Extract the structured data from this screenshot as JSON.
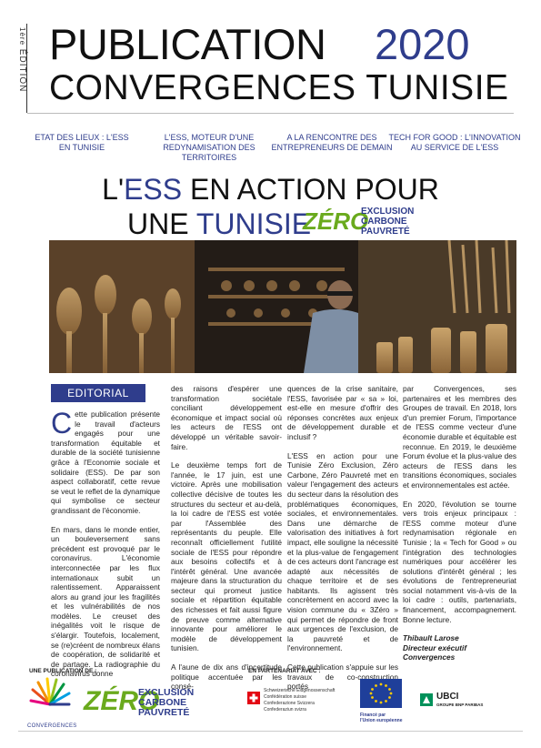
{
  "header": {
    "edition_sup": "1ère",
    "edition": "ÉDITION",
    "title_line1": "PUBLICATION",
    "year": "2020",
    "title_line2": "CONVERGENCES TUNISIE"
  },
  "topics": [
    "ETAT DES LIEUX : L'ESS\nEN TUNISIE",
    "L'ESS, MOTEUR D'UNE\nREDYNAMISATION DES TERRITOIRES",
    "A LA RENCONTRE DES\nENTREPRENEURS DE DEMAIN",
    "TECH FOR GOOD : L'INNOVATION\nAU SERVICE DE L'ESS"
  ],
  "headline": {
    "l_prefix": "L'",
    "ess": "ESS",
    "line1_rest": " EN ACTION POUR",
    "une": "UNE ",
    "tunisie": "TUNISIE"
  },
  "zero_logo": {
    "zero": "ZÉRO",
    "exclusion": "EXCLUSION",
    "carbone": "CARBONE",
    "pauvrete": "PAUVRETÉ"
  },
  "editorial": {
    "tab_label": "EDITORIAL",
    "dropcap": "C",
    "col1": [
      "ette publication présente le travail d'acteurs engagés pour une transformation équitable et durable de la société tunisienne grâce à l'Economie sociale et solidaire (ESS). De par son aspect collaboratif, cette revue se veut le reflet de la dynamique qui symbolise ce secteur grandissant de l'économie.",
      "En mars, dans le monde entier, un bouleversement sans précédent est provoqué par le coronavirus. L'économie interconnectée par les flux internationaux subit un ralentissement. Apparaissent alors au grand jour les fragilités et les vulnérabilités de nos modèles. Le creuset des inégalités voit le risque de s'élargir. Toutefois, localement, se (re)créent de nombreux élans de coopération, de solidarité et de partage. La radiographie du coronavirus donne"
    ],
    "col2": [
      "des raisons d'espérer une transformation sociétale conciliant développement économique et impact social où les acteurs de l'ESS ont développé un véritable savoir-faire.",
      "Le deuxième temps fort de l'année, le 17 juin, est une victoire. Après une mobilisation collective décisive de toutes les structures du secteur et au-delà, la loi cadre de l'ESS est votée par l'Assemblée des représentants du peuple. Elle reconnaît officiellement l'utilité sociale de l'ESS pour répondre aux besoins collectifs et à l'intérêt général. Une avancée majeure dans la structuration du secteur qui promeut justice sociale et répartition équitable des richesses et fait aussi figure de preuve comme alternative innovante pour améliorer le modèle de développement tunisien.",
      "A l'aune de dix ans d'incertitude politique accentuée par les consé-"
    ],
    "col3": [
      "quences de la crise sanitaire, l'ESS, favorisée par « sa » loi, est-elle en mesure d'offrir des réponses concrètes aux enjeux de développement durable et inclusif ?",
      "L'ESS en action pour une Tunisie Zéro Exclusion, Zéro Carbone, Zéro Pauvreté met en valeur l'engagement des acteurs du secteur dans la résolution des problématiques économiques, sociales, et environnementales. Dans une démarche de valorisation des initiatives à fort impact, elle souligne la nécessité et la plus-value de l'engagement de ces acteurs dont l'ancrage est adapté aux nécessités de chaque territoire et de ses habitants. Ils agissent très concrètement en accord avec la vision commune du « 3Zéro » qui permet de répondre de front aux urgences de l'exclusion, de la pauvreté et de l'environnement.",
      "Cette publication s'appuie sur les travaux de co-construction portés"
    ],
    "col4": [
      "par Convergences, ses partenaires et les membres des Groupes de travail. En 2018, lors d'un premier Forum, l'importance de l'ESS comme vecteur d'une économie durable et équitable est reconnue. En 2019, le deuxième Forum évolue et la plus-value des acteurs de l'ESS dans les transitions économiques, sociales et environnementales est actée.",
      "En 2020, l'évolution se tourne vers trois enjeux principaux : l'ESS comme moteur d'une redynamisation régionale en Tunisie ; la « Tech for Good » ou l'intégration des technologies numériques pour accélérer les solutions d'intérêt général ; les évolutions de l'entrepreneuriat social notamment vis-à-vis de la loi cadre : outils, partenariats, financement, accompagnement. Bonne lecture."
    ],
    "signature": [
      "Thibault Larose",
      "Directeur exécutif",
      "Convergences"
    ]
  },
  "footer": {
    "publication_label": "UNE PUBLICATION DE :",
    "partner_label": "EN PARTENARIAT AVEC :",
    "convergences": "CONVERGENCES",
    "swiss_lines": [
      "Schweizerische Eidgenossenschaft",
      "Confédération suisse",
      "Confederazione Svizzera",
      "Confederaziun svizra"
    ],
    "eu_lines": [
      "Financé par",
      "l'Union européenne"
    ],
    "ubci": "UBCI",
    "ubci_sub": "GROUPE BNP PARIBAS"
  },
  "colors": {
    "accent": "#2f3d8c",
    "green": "#6aaa1d"
  }
}
